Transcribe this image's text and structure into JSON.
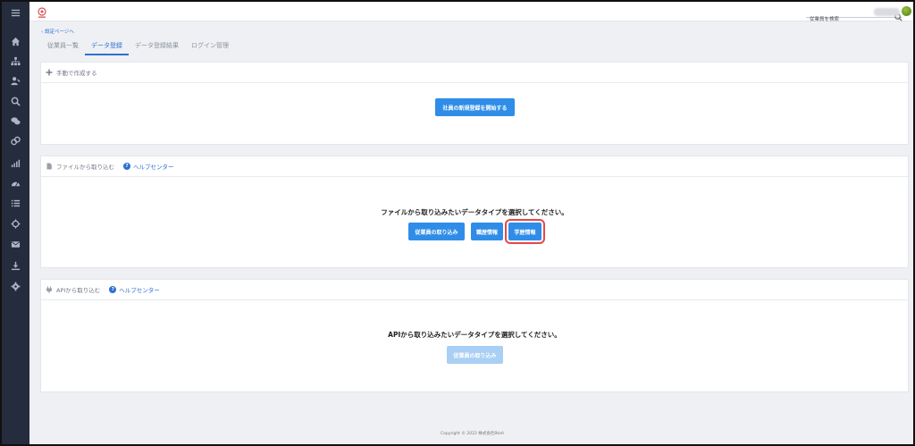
{
  "topbar": {
    "search_placeholder": "従業員を検索",
    "icons": {
      "logo": "company-logo-icon",
      "search": "search-icon",
      "menu": "hamburger-menu-icon"
    },
    "accent_color": "#2e6fd1"
  },
  "sidebar": {
    "items": [
      {
        "name": "home-icon"
      },
      {
        "name": "org-chart-icon"
      },
      {
        "name": "user-edit-icon"
      },
      {
        "name": "search-icon"
      },
      {
        "name": "chat-icon"
      },
      {
        "name": "link-icon"
      },
      {
        "name": "bar-chart-icon"
      },
      {
        "name": "dashboard-gauge-icon"
      },
      {
        "name": "list-icon"
      },
      {
        "name": "crosshair-icon"
      },
      {
        "name": "mail-icon"
      },
      {
        "name": "download-icon"
      },
      {
        "name": "gear-icon"
      }
    ]
  },
  "breadcrumb": "‹ 設定ページへ",
  "tabs": [
    {
      "label": "従業員一覧",
      "active": false
    },
    {
      "label": "データ登録",
      "active": true
    },
    {
      "label": "データ登録結果",
      "active": false
    },
    {
      "label": "ログイン管理",
      "active": false
    }
  ],
  "manual_panel": {
    "title": "手動で作成する",
    "button": "社員の新規登録を開始する"
  },
  "file_panel": {
    "title": "ファイルから取り込む",
    "help": "ヘルプセンター",
    "prompt": "ファイルから取り込みたいデータタイプを選択してください。",
    "buttons": [
      "従業員の取り込み",
      "職歴情報",
      "学歴情報"
    ]
  },
  "api_panel": {
    "title": "APIから取り込む",
    "help": "ヘルプセンター",
    "prompt": "APIから取り込みたいデータタイプを選択してください。",
    "button": "従業員の取り込み"
  },
  "footer": "Copyright © 2022 株式会社BtoA",
  "colors": {
    "primary_button": "#2f8de8",
    "disabled_button": "#a9cff4",
    "highlight_border": "#e54848",
    "sidebar_bg": "#252c3d"
  }
}
